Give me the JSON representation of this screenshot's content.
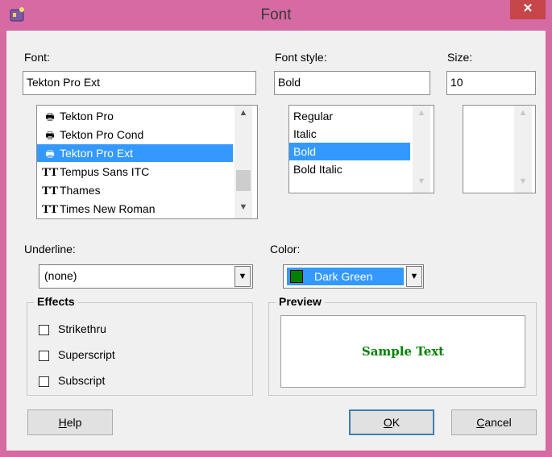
{
  "window": {
    "title": "Font",
    "close_glyph": "✕",
    "app_icon": "font-app-icon"
  },
  "font": {
    "label": "Font:",
    "value": "Tekton Pro Ext",
    "items": [
      {
        "name": "Tekton Pro",
        "icon": "printer-font-icon",
        "glyph": "🖶"
      },
      {
        "name": "Tekton Pro Cond",
        "icon": "printer-font-icon",
        "glyph": "🖶"
      },
      {
        "name": "Tekton Pro Ext",
        "icon": "printer-font-icon",
        "glyph": "🖶",
        "selected": true
      },
      {
        "name": "Tempus Sans ITC",
        "icon": "truetype-icon",
        "glyph": "TT"
      },
      {
        "name": "Thames",
        "icon": "truetype-icon",
        "glyph": "TT"
      },
      {
        "name": "Times New Roman",
        "icon": "truetype-icon",
        "glyph": "TT"
      }
    ]
  },
  "font_style": {
    "label": "Font style:",
    "value": "Bold",
    "items": [
      {
        "name": "Regular"
      },
      {
        "name": "Italic"
      },
      {
        "name": "Bold",
        "selected": true
      },
      {
        "name": "Bold Italic"
      }
    ]
  },
  "size": {
    "label": "Size:",
    "value": "10"
  },
  "underline": {
    "label": "Underline:",
    "value": "(none)"
  },
  "color": {
    "label": "Color:",
    "value": "Dark Green",
    "swatch": "#008000",
    "highlight": "#3399ff"
  },
  "effects": {
    "title": "Effects",
    "options": [
      {
        "label": "Strikethru",
        "checked": false
      },
      {
        "label": "Superscript",
        "checked": false
      },
      {
        "label": "Subscript",
        "checked": false
      }
    ]
  },
  "preview": {
    "title": "Preview",
    "sample": "Sample Text",
    "color": "#008000"
  },
  "buttons": {
    "help": {
      "mnemonic": "H",
      "rest": "elp"
    },
    "ok": {
      "mnemonic": "O",
      "rest": "K"
    },
    "cancel": {
      "mnemonic": "C",
      "rest": "ancel"
    }
  }
}
